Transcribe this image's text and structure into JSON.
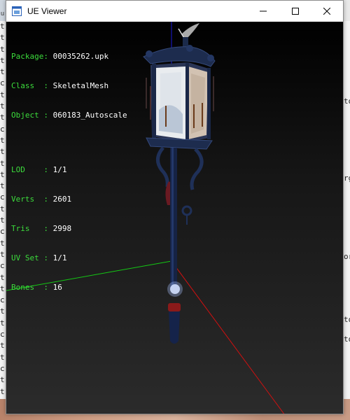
{
  "window": {
    "title": "UE Viewer",
    "minimize_glyph": "minimize-icon",
    "maximize_glyph": "maximize-icon",
    "close_glyph": "close-icon"
  },
  "overlay": {
    "package_label": "Package:",
    "package_value": "00035262.upk",
    "class_label": "Class  :",
    "class_value": "SkeletalMesh",
    "object_label": "Object :",
    "object_value": "060183_Autoscale",
    "lod_label": "LOD    :",
    "lod_value": "1/1",
    "verts_label": "Verts  :",
    "verts_value": "2601",
    "tris_label": "Tris   :",
    "tris_value": "2998",
    "uvset_label": "UV Set :",
    "uvset_value": "1/1",
    "bones_label": "Bones  :",
    "bones_value": "16"
  },
  "background_window": {
    "top_fragment": "u",
    "left_column": [
      "t",
      "t",
      "t",
      "t",
      "t",
      "c",
      "t",
      "t",
      "t",
      "c",
      "t",
      "t",
      "t",
      "t",
      "t",
      "c",
      "t",
      "t",
      "c",
      "t",
      "t",
      "c",
      "t",
      "t",
      "c",
      "t",
      "t",
      "c",
      "t",
      "t",
      "c",
      "t",
      "t"
    ],
    "right_fragments": [
      "to",
      "rg",
      "or",
      "to",
      "to"
    ]
  },
  "colors": {
    "overlay_label": "#3cdc3c",
    "overlay_value": "#ffffff",
    "axis_x": "#d01010",
    "axis_y": "#10c010",
    "axis_z": "#1010d0"
  }
}
